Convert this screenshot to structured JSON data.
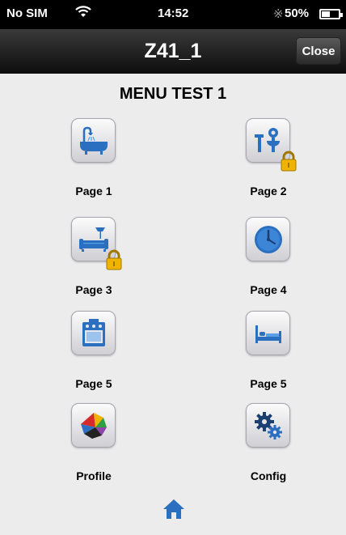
{
  "status_bar": {
    "carrier": "No SIM",
    "time": "14:52",
    "battery": "50%"
  },
  "nav": {
    "title": "Z41_1",
    "close_label": "Close"
  },
  "menu_title": "MENU TEST 1",
  "tiles": [
    {
      "label": "Page 1",
      "icon": "bathtub-icon",
      "locked": false
    },
    {
      "label": "Page 2",
      "icon": "faucet-icon",
      "locked": true
    },
    {
      "label": "Page 3",
      "icon": "sofa-lamp-icon",
      "locked": true
    },
    {
      "label": "Page 4",
      "icon": "clock-icon",
      "locked": false
    },
    {
      "label": "Page 5",
      "icon": "oven-icon",
      "locked": false
    },
    {
      "label": "Page 5",
      "icon": "bed-icon",
      "locked": false
    },
    {
      "label": "Profile",
      "icon": "color-palette-icon",
      "locked": false
    },
    {
      "label": "Config",
      "icon": "gears-icon",
      "locked": false
    }
  ],
  "colors": {
    "icon_blue": "#2a6fc0",
    "lock_gold": "#f0b400",
    "nav_bg": "#1a1a1a",
    "page_bg": "#ececed"
  }
}
